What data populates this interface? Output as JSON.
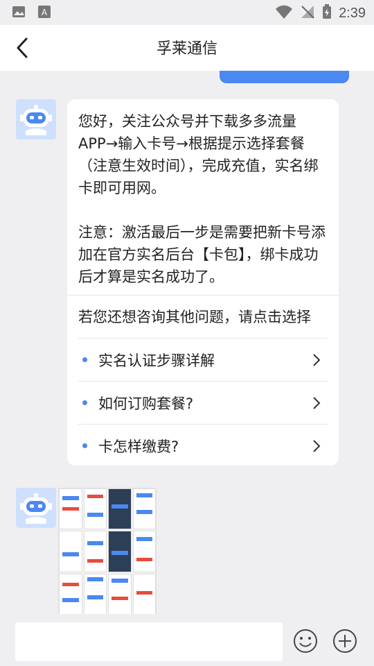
{
  "status_bar": {
    "time": "2:39"
  },
  "header": {
    "title": "孚莱通信"
  },
  "bot_message": {
    "text": "您好，关注公众号并下载多多流量APP→输入卡号→根据提示选择套餐（注意生效时间），完成充值，实名绑卡即可用网。\n\n注意：激活最后一步是需要把新卡号添加在官方实名后台【卡包】，绑卡成功后才算是实名成功了。",
    "prompt": "若您还想咨询其他问题，请点击选择",
    "options": [
      {
        "label": "实名认证步骤详解"
      },
      {
        "label": "如何订购套餐?"
      },
      {
        "label": "卡怎样缴费?"
      }
    ]
  },
  "input": {
    "placeholder": ""
  },
  "colors": {
    "accent": "#4b88f1",
    "background": "#efeff1"
  },
  "icons": [
    "image-icon",
    "text-icon",
    "wifi-icon",
    "signal-off-icon",
    "battery-charging-icon",
    "back-arrow-icon",
    "robot-avatar-icon",
    "chevron-right-icon",
    "emoji-icon",
    "plus-icon"
  ]
}
